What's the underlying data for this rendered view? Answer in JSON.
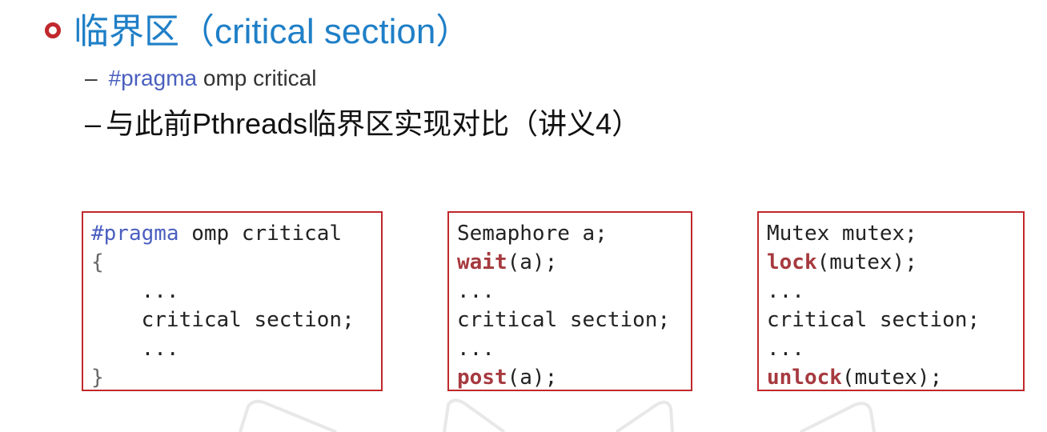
{
  "title": {
    "text": "临界区（critical section）"
  },
  "subpoints": [
    {
      "dash": "–",
      "keyword": "#pragma",
      "rest": " omp critical"
    },
    {
      "dash": "–",
      "text": "与此前Pthreads临界区实现对比（讲义4）"
    }
  ],
  "code_boxes": {
    "omp": {
      "line1_kw": "#pragma",
      "line1_rest": " omp critical",
      "open_brace": "{",
      "dots1": "    ...",
      "body": "    critical section;",
      "dots2": "    ...",
      "close_brace": "}"
    },
    "semaphore": {
      "decl": "Semaphore a;",
      "wait_fn": "wait",
      "wait_args": "(a);",
      "dots1": "...",
      "body": "critical section;",
      "dots2": "...",
      "post_fn": "post",
      "post_args": "(a);"
    },
    "mutex": {
      "decl": "Mutex mutex;",
      "lock_fn": "lock",
      "lock_args": "(mutex);",
      "dots1": "...",
      "body": "critical section;",
      "dots2": "...",
      "unlock_fn": "unlock",
      "unlock_args": "(mutex);"
    }
  },
  "colors": {
    "title": "#1f7fc7",
    "bullet": "#c0282d",
    "box_border": "#c0282d",
    "keyword": "#4a5fbf",
    "function": "#a63a3f"
  }
}
